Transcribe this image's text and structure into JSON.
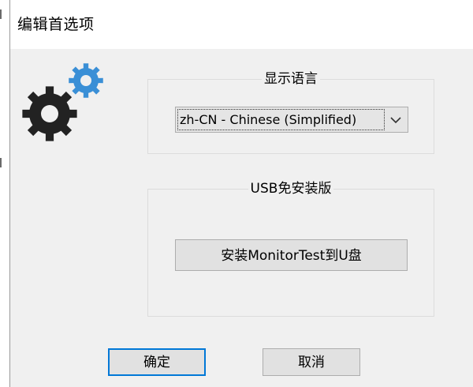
{
  "dialog": {
    "title": "编辑首选项"
  },
  "display_language": {
    "group_title": "显示语言",
    "selected_value": "zh-CN - Chinese (Simplified)"
  },
  "usb_portable": {
    "group_title": "USB免安装版",
    "install_button_label": "安装MonitorTest到U盘"
  },
  "footer": {
    "ok_label": "确定",
    "cancel_label": "取消"
  },
  "colors": {
    "gear_large": "#222222",
    "gear_small": "#3a8fd6",
    "focus_border": "#0078d7",
    "dialog_bg": "#f0f0f0"
  },
  "icons": {
    "settings_gears": "gear-icon",
    "dropdown": "chevron-down-icon"
  }
}
